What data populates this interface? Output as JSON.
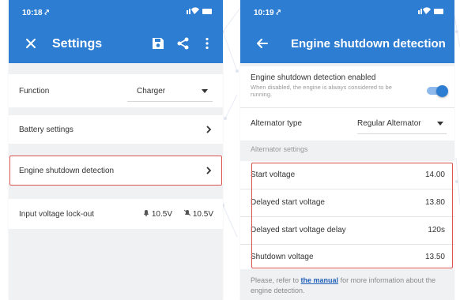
{
  "colors": {
    "accent": "#2d7dd2",
    "highlight": "#d9534f",
    "background": "#f0f1f3"
  },
  "screen1": {
    "status": {
      "time": "10:18 ⤤",
      "icons": "⌗ ᯤ ▬"
    },
    "appbar": {
      "title": "Settings",
      "nav_icon": "close-icon",
      "actions": [
        "save-icon",
        "share-icon",
        "more-vert-icon"
      ]
    },
    "function_row": {
      "label": "Function",
      "value": "Charger"
    },
    "battery_row": {
      "label": "Battery settings"
    },
    "engine_row": {
      "label": "Engine shutdown detection"
    },
    "input_row": {
      "label": "Input voltage lock-out",
      "value1": "10.5V",
      "value2": "10.5V"
    }
  },
  "screen2": {
    "status": {
      "time": "10:19 ⤤",
      "icons": "⌗ ᯤ ▬"
    },
    "appbar": {
      "title": "Engine shutdown detection",
      "nav_icon": "back-arrow-icon"
    },
    "enabled": {
      "label": "Engine shutdown detection enabled",
      "hint": "When disabled, the engine is always considered to be running.",
      "on": true
    },
    "alternator_type": {
      "label": "Alternator type",
      "value": "Regular Alternator"
    },
    "section_header": "Alternator settings",
    "settings": [
      {
        "label": "Start voltage",
        "value": "14.00"
      },
      {
        "label": "Delayed start voltage",
        "value": "13.80"
      },
      {
        "label": "Delayed start voltage delay",
        "value": "120s"
      },
      {
        "label": "Shutdown voltage",
        "value": "13.50"
      }
    ],
    "note": {
      "prefix": "Please, refer to ",
      "link": "the manual",
      "suffix": " for more information about the engine detection."
    }
  }
}
